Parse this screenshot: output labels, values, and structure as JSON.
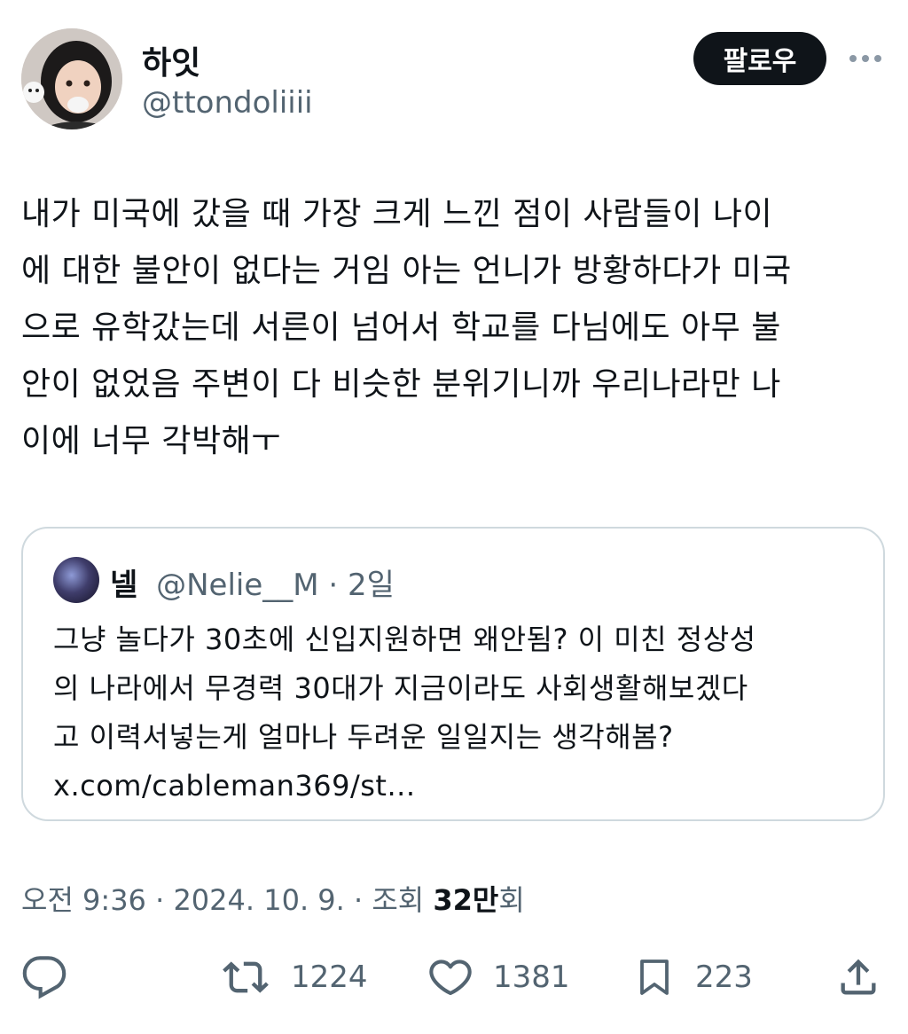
{
  "author": {
    "display_name": "하잇",
    "handle": "@ttondoliiii",
    "avatar_icon": "profile-photo"
  },
  "follow_label": "팔로우",
  "more_icon": "more-horizontal-icon",
  "tweet_text": "내가 미국에 갔을 때 가장 크게 느낀 점이 사람들이 나이\n에 대한 불안이 없다는 거임 아는 언니가 방황하다가 미국\n으로 유학갔는데 서른이 넘어서 학교를 다님에도 아무 불\n안이 없었음 주변이 다 비슷한 분위기니까 우리나라만 나\n이에 너무 각박해ㅜ",
  "quote": {
    "display_name": "넬",
    "handle": "@Nelie__M",
    "separator": " · ",
    "time": "2일",
    "text": "그냥 놀다가 30초에 신입지원하면 왜안됨? 이 미친 정상성\n의 나라에서 무경력 30대가 지금이라도 사회생활해보겠다\n고 이력서넣는게 얼마나 두려운 일일지는 생각해봄?\nx.com/cableman369/st..."
  },
  "meta": {
    "time": "오전 9:36",
    "sep1": " · ",
    "date": "2024. 10. 9.",
    "sep2": " · ",
    "views_label": "조회 ",
    "views_count": "32만",
    "views_suffix": "회"
  },
  "actions": {
    "reply": {
      "icon": "reply-icon"
    },
    "retweet": {
      "icon": "retweet-icon",
      "count": "1224"
    },
    "like": {
      "icon": "heart-icon",
      "count": "1381"
    },
    "bookmark": {
      "icon": "bookmark-icon",
      "count": "223"
    },
    "share": {
      "icon": "share-icon"
    }
  },
  "colors": {
    "text": "#0f1419",
    "secondary": "#536471",
    "border": "#cfd9de",
    "follow_bg": "#0f1419"
  }
}
